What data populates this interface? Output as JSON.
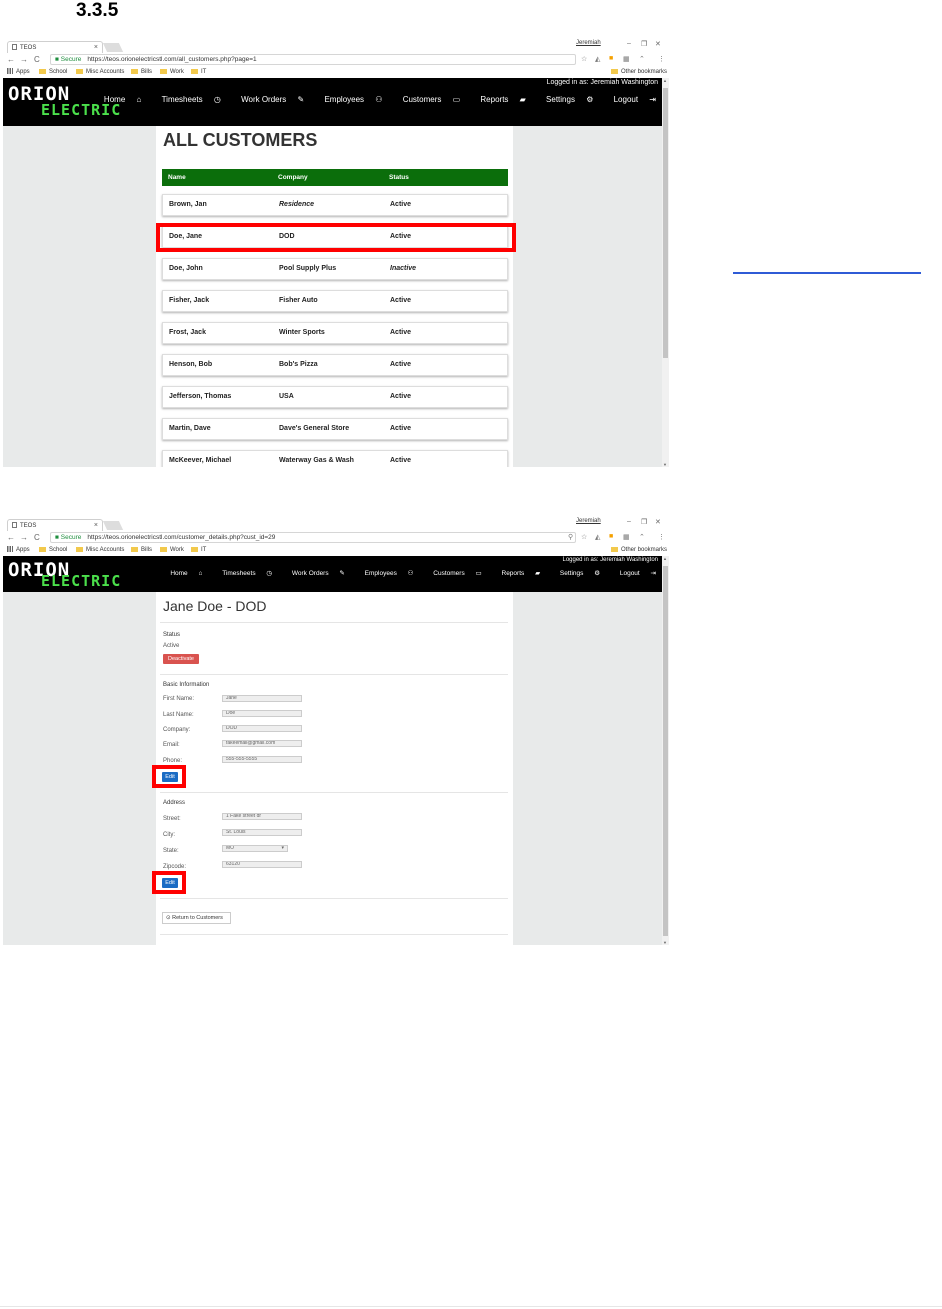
{
  "doc": {
    "section_number": "3.3.5"
  },
  "browser": {
    "tab_title": "TEOS",
    "user_chip": "Jeremiah",
    "secure_label": "Secure",
    "bookmarks": [
      "Apps",
      "School",
      "Misc Accounts",
      "Bills",
      "Work",
      "IT"
    ],
    "other_bookmarks": "Other bookmarks"
  },
  "site": {
    "logo_top": "ORION",
    "logo_bottom": "ELECTRIC",
    "logged_in": "Logged in as: Jeremiah Washington",
    "nav": [
      "Home",
      "Timesheets",
      "Work Orders",
      "Employees",
      "Customers",
      "Reports",
      "Settings",
      "Logout"
    ]
  },
  "shot1": {
    "url": "https://teos.orionelectricstl.com/all_customers.php?page=1",
    "heading": "ALL CUSTOMERS",
    "columns": [
      "Name",
      "Company",
      "Status"
    ],
    "rows": [
      {
        "name": "Brown, Jan",
        "company": "Residence",
        "status": "Active"
      },
      {
        "name": "Doe, Jane",
        "company": "DOD",
        "status": "Active"
      },
      {
        "name": "Doe, John",
        "company": "Pool Supply Plus",
        "status": "Inactive"
      },
      {
        "name": "Fisher, Jack",
        "company": "Fisher Auto",
        "status": "Active"
      },
      {
        "name": "Frost, Jack",
        "company": "Winter Sports",
        "status": "Active"
      },
      {
        "name": "Henson, Bob",
        "company": "Bob's Pizza",
        "status": "Active"
      },
      {
        "name": "Jefferson, Thomas",
        "company": "USA",
        "status": "Active"
      },
      {
        "name": "Martin, Dave",
        "company": "Dave's General Store",
        "status": "Active"
      },
      {
        "name": "McKeever, Michael",
        "company": "Waterway Gas & Wash",
        "status": "Active"
      }
    ]
  },
  "shot2": {
    "url": "https://teos.orionelectricstl.com/customer_details.php?cust_id=29",
    "title": "Jane Doe - DOD",
    "status_heading": "Status",
    "status_value": "Active",
    "deactivate_label": "Deactivate",
    "basic_heading": "Basic Information",
    "first_name_label": "First Name:",
    "first_name": "Jane",
    "last_name_label": "Last Name:",
    "last_name": "Doe",
    "company_label": "Company:",
    "company": "DOD",
    "email_label": "Email:",
    "email": "fakeemail@gmail.com",
    "phone_label": "Phone:",
    "phone": "555-555-5555",
    "edit_label": "Edit",
    "address_heading": "Address",
    "street_label": "Street:",
    "street": "1 Fake street dr",
    "city_label": "City:",
    "city": "St. Louis",
    "state_label": "State:",
    "state": "MO",
    "zip_label": "Zipcode:",
    "zip": "63120",
    "return_label": "Return to Customers"
  },
  "colors": {
    "navbar": "#000000",
    "logo_green": "#4be04b",
    "table_header": "#0b6e0b",
    "highlight": "#ff0000",
    "edit_button": "#1a6cc4",
    "deactivate_button": "#d9534f"
  }
}
